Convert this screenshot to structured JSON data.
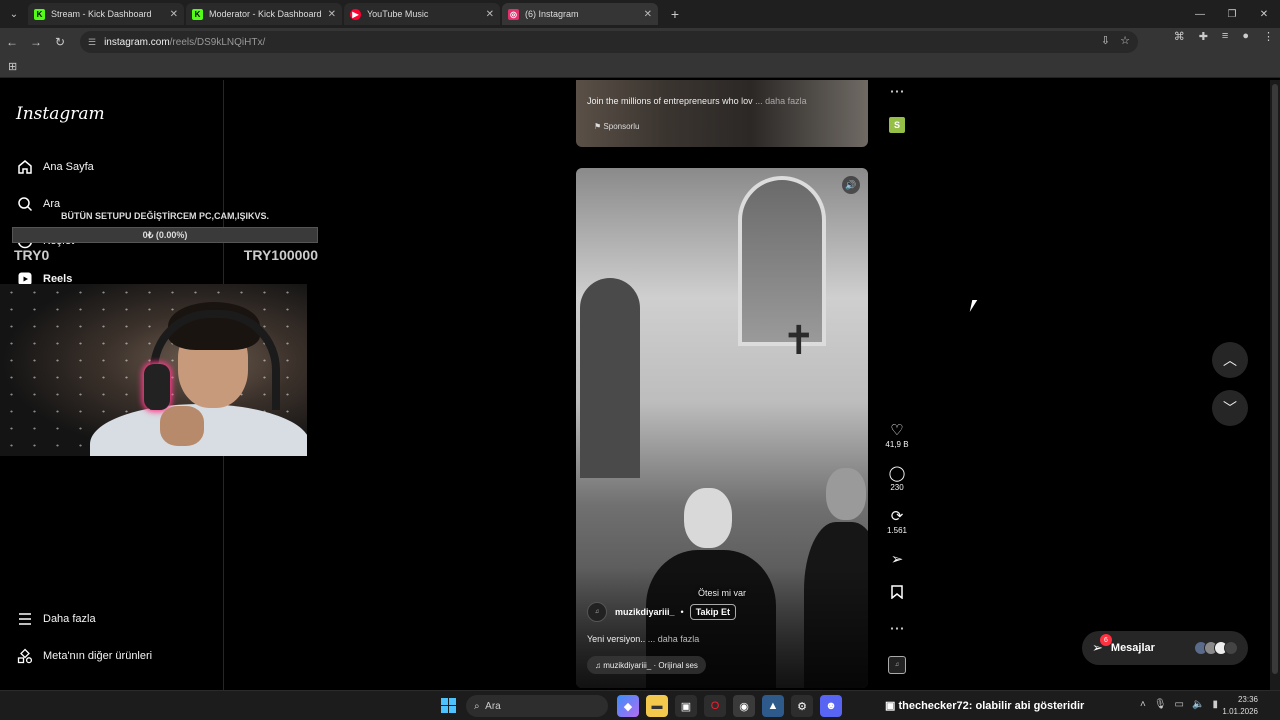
{
  "browser": {
    "tabs": [
      {
        "title": "Stream - Kick Dashboard",
        "favicon_color": "#53fc18",
        "favicon_letter": "K"
      },
      {
        "title": "Moderator - Kick Dashboard",
        "favicon_color": "#53fc18",
        "favicon_letter": "K"
      },
      {
        "title": "YouTube Music",
        "favicon_color": "#ff0033",
        "favicon_letter": "▶"
      },
      {
        "title": "(6) Instagram",
        "favicon_color": "#e1306c",
        "favicon_letter": "◎"
      }
    ],
    "url_host": "instagram.com",
    "url_path": "/reels/DS9kLNQiHTx/",
    "new_tab_icon": "plus-icon"
  },
  "sidebar": {
    "logo": "Instagram",
    "items": [
      {
        "label": "Ana Sayfa",
        "icon": "home-icon"
      },
      {
        "label": "Ara",
        "icon": "search-icon"
      },
      {
        "label": "Keşfet",
        "icon": "compass-icon"
      },
      {
        "label": "Reels",
        "icon": "reels-icon"
      }
    ],
    "bottom": [
      {
        "label": "Daha fazla",
        "icon": "menu-icon"
      },
      {
        "label": "Meta'nın diğer ürünleri",
        "icon": "meta-products-icon"
      }
    ]
  },
  "overlay": {
    "goal_title": "BÜTÜN SETUPU DEĞİŞTİRCEM PC,CAM,IŞIKVS.",
    "goal_progress": "0₺ (0.00%)",
    "goal_fraction": 0.0,
    "goal_min": "TRY0",
    "goal_max": "TRY100000"
  },
  "ad": {
    "text": "Join the millions of entrepreneurs who lov",
    "more": "... daha fazla",
    "sponsor": "Sponsorlu"
  },
  "reel": {
    "overlay_text": "Ötesi mi var",
    "author": "muzikdiyariii_",
    "follow": "Takip Et",
    "description": "Yeni versiyon..",
    "more": "... daha fazla",
    "audio": "muzikdiyariii_ · Orijinal ses",
    "likes": "41,9 B",
    "comments": "230",
    "reposts": "1.561"
  },
  "messages": {
    "label": "Mesajlar",
    "badge": "6"
  },
  "taskbar": {
    "search": "Ara",
    "chat_user": "thechecker72",
    "chat_text": ": olabilir abi gösteridir",
    "time": "23:36",
    "date": "1.01.2026"
  }
}
